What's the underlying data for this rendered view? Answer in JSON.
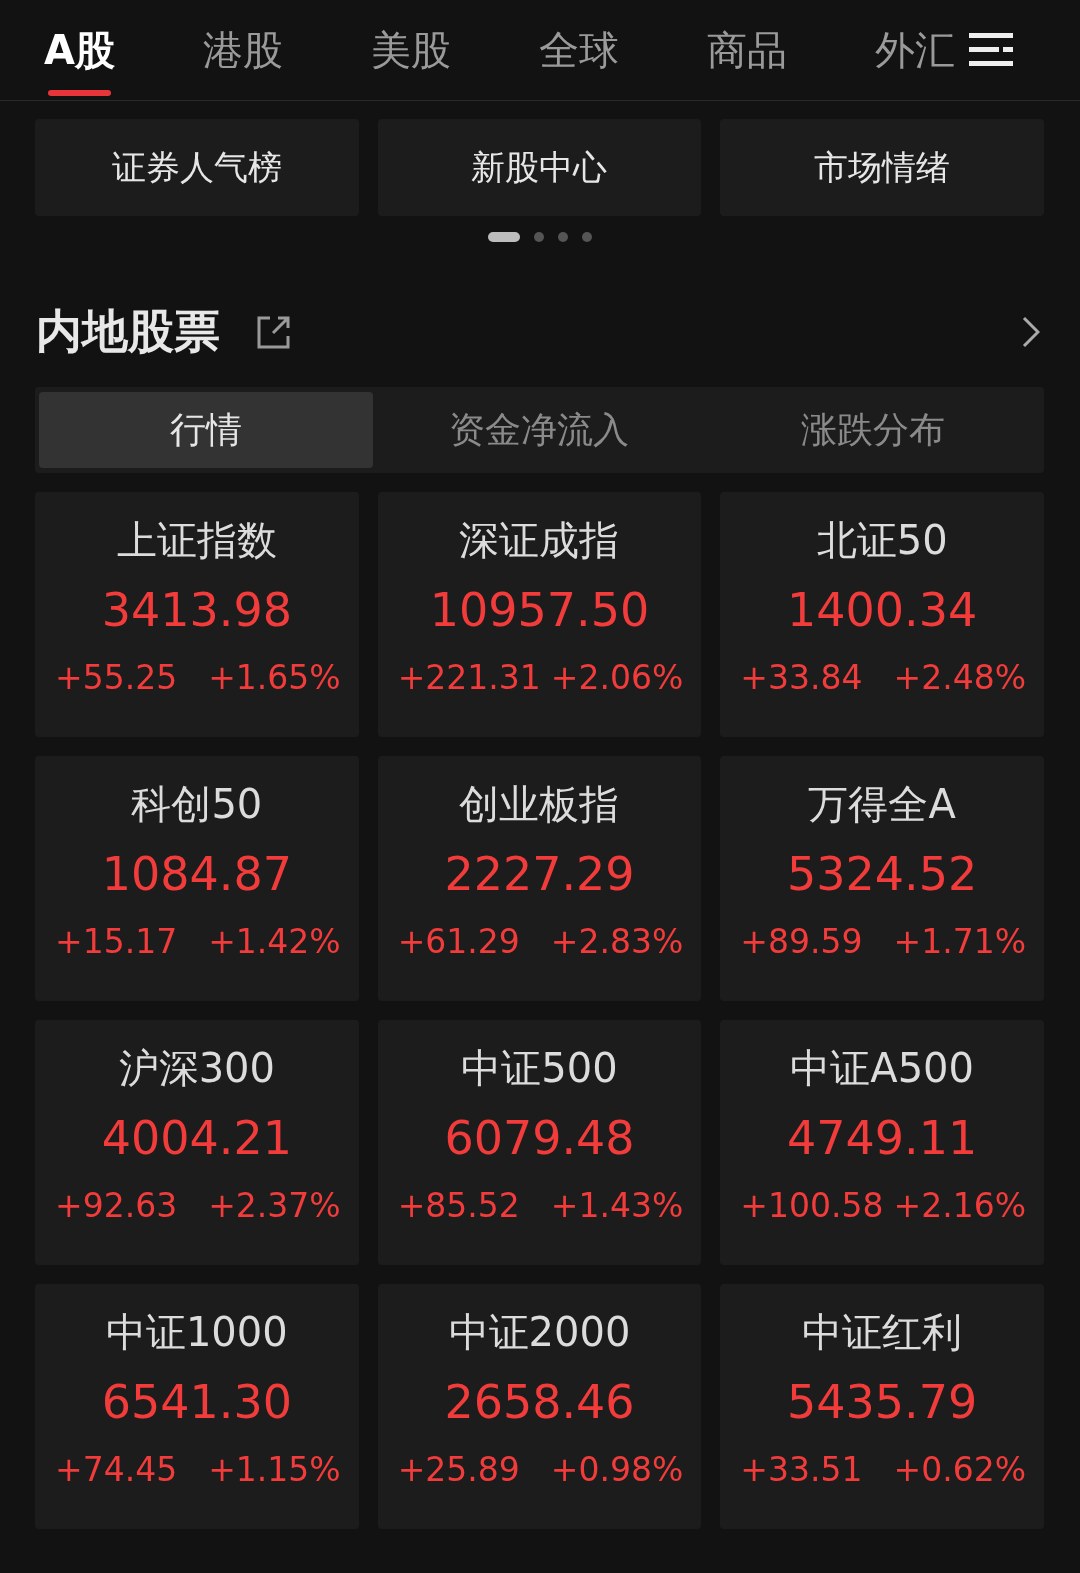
{
  "market_tabs": [
    {
      "label": "A股",
      "selected": true
    },
    {
      "label": "港股",
      "selected": false
    },
    {
      "label": "美股",
      "selected": false
    },
    {
      "label": "全球",
      "selected": false
    },
    {
      "label": "商品",
      "selected": false
    },
    {
      "label": "外汇",
      "selected": false
    }
  ],
  "shortcuts": [
    "证券人气榜",
    "新股中心",
    "市场情绪"
  ],
  "pager": [
    {
      "selected": true
    },
    {
      "selected": false
    },
    {
      "selected": false
    },
    {
      "selected": false
    }
  ],
  "section": {
    "title": "内地股票"
  },
  "segments": [
    {
      "label": "行情",
      "selected": true
    },
    {
      "label": "资金净流入",
      "selected": false
    },
    {
      "label": "涨跌分布",
      "selected": false
    }
  ],
  "indices": [
    {
      "name": "上证指数",
      "value": "3413.98",
      "change": "+55.25",
      "percent": "+1.65%"
    },
    {
      "name": "深证成指",
      "value": "10957.50",
      "change": "+221.31",
      "percent": "+2.06%"
    },
    {
      "name": "北证50",
      "value": "1400.34",
      "change": "+33.84",
      "percent": "+2.48%"
    },
    {
      "name": "科创50",
      "value": "1084.87",
      "change": "+15.17",
      "percent": "+1.42%"
    },
    {
      "name": "创业板指",
      "value": "2227.29",
      "change": "+61.29",
      "percent": "+2.83%"
    },
    {
      "name": "万得全A",
      "value": "5324.52",
      "change": "+89.59",
      "percent": "+1.71%"
    },
    {
      "name": "沪深300",
      "value": "4004.21",
      "change": "+92.63",
      "percent": "+2.37%"
    },
    {
      "name": "中证500",
      "value": "6079.48",
      "change": "+85.52",
      "percent": "+1.43%"
    },
    {
      "name": "中证A500",
      "value": "4749.11",
      "change": "+100.58",
      "percent": "+2.16%"
    },
    {
      "name": "中证1000",
      "value": "6541.30",
      "change": "+74.45",
      "percent": "+1.15%"
    },
    {
      "name": "中证2000",
      "value": "2658.46",
      "change": "+25.89",
      "percent": "+0.98%"
    },
    {
      "name": "中证红利",
      "value": "5435.79",
      "change": "+33.51",
      "percent": "+0.62%"
    }
  ]
}
